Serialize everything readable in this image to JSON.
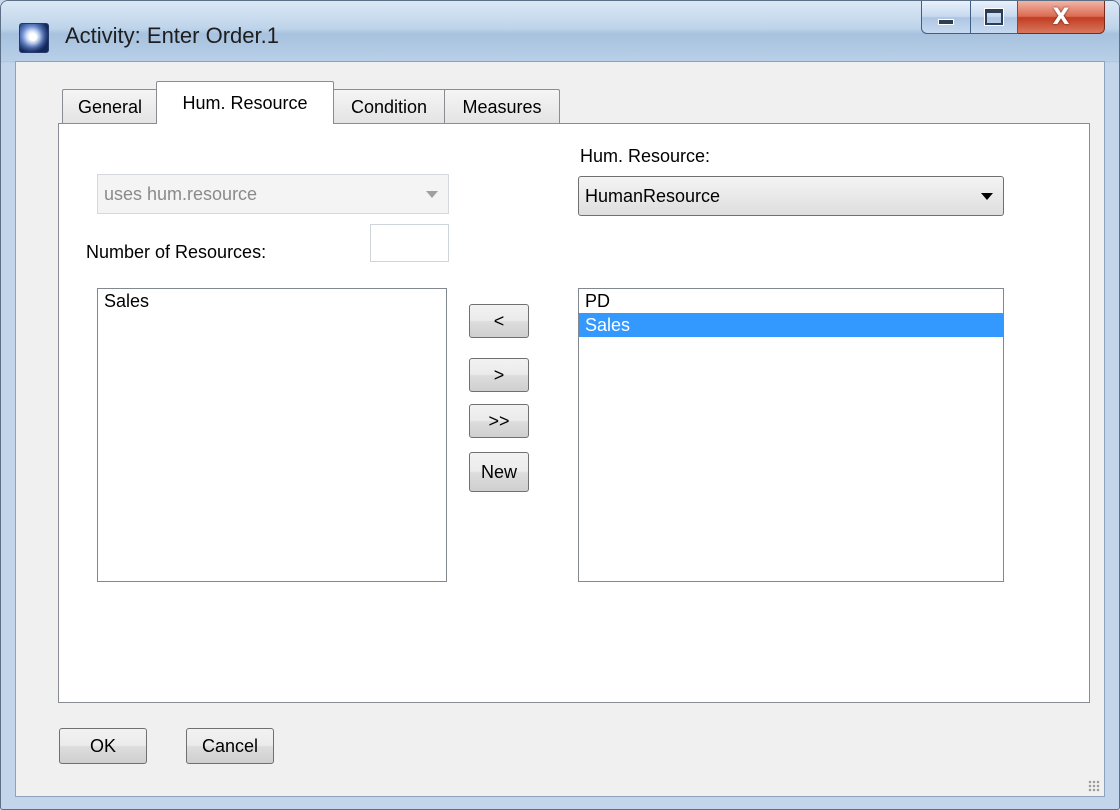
{
  "window": {
    "title": "Activity: Enter Order.1",
    "close_glyph": "X"
  },
  "tabs": [
    {
      "label": "General"
    },
    {
      "label": "Hum. Resource"
    },
    {
      "label": "Condition"
    },
    {
      "label": "Measures"
    }
  ],
  "uses_combo": {
    "value": "uses hum.resource"
  },
  "number_of_resources": {
    "label": "Number of Resources:",
    "value": ""
  },
  "resource_combo": {
    "label": "Hum. Resource:",
    "value": "HumanResource"
  },
  "assigned_list": {
    "items": [
      "Sales"
    ]
  },
  "available_list": {
    "items": [
      "PD",
      "Sales"
    ],
    "selected": "Sales"
  },
  "transfer_buttons": {
    "add": "<",
    "remove": ">",
    "remove_all": ">>",
    "new": "New"
  },
  "footer": {
    "ok": "OK",
    "cancel": "Cancel"
  },
  "icons": [
    "app-icon",
    "minimize-icon",
    "maximize-icon",
    "close-icon",
    "dropdown-arrow-icon",
    "size-grip-icon"
  ]
}
